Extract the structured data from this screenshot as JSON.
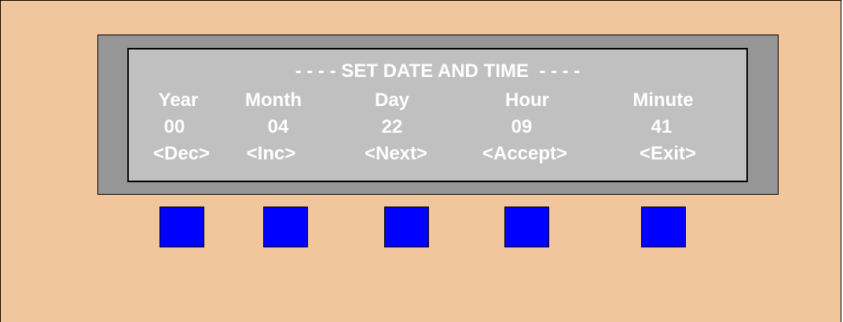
{
  "lcd": {
    "title": "- - - - SET DATE AND TIME  - - - -",
    "columns": [
      {
        "label": "Year",
        "value": "00",
        "softkey": "<Dec>"
      },
      {
        "label": "Month",
        "value": "04",
        "softkey": "<Inc>"
      },
      {
        "label": "Day",
        "value": "22",
        "softkey": "<Next>"
      },
      {
        "label": "Hour",
        "value": "09",
        "softkey": "<Accept>"
      },
      {
        "label": "Minute",
        "value": "41",
        "softkey": "<Exit>"
      }
    ]
  },
  "colors": {
    "panel": "#f2c69c",
    "bezel": "#969696",
    "lcd": "#c0c0c0",
    "lcd_text": "#ffffff",
    "keys": "#0000ff"
  }
}
